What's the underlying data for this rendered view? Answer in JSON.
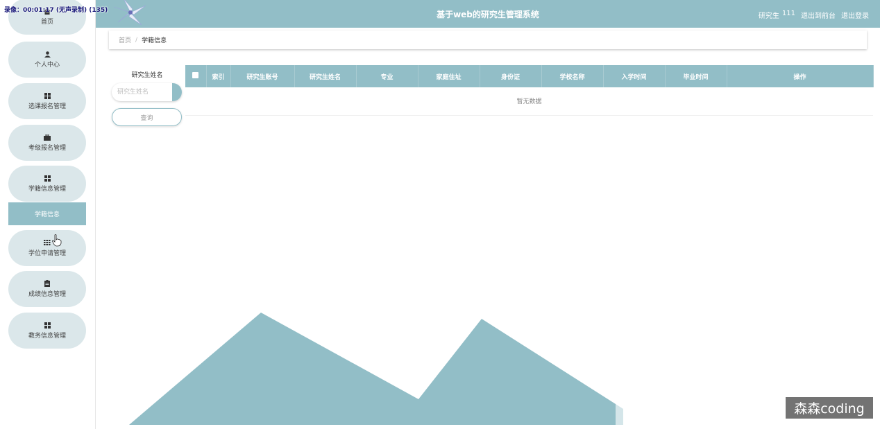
{
  "recording_overlay": "录像：00:01:17 (无声录制) (135)",
  "header": {
    "title": "基于web的研究生管理系统",
    "user_role": "研究生",
    "user_name": "111",
    "back_to_front": "退出到前台",
    "logout": "退出登录"
  },
  "sidebar": {
    "items": [
      {
        "label": "首页",
        "icon": "home-icon"
      },
      {
        "label": "个人中心",
        "icon": "user-icon"
      },
      {
        "label": "选课报名管理",
        "icon": "grid-icon"
      },
      {
        "label": "考级报名管理",
        "icon": "briefcase-icon"
      },
      {
        "label": "学籍信息管理",
        "icon": "grid-icon"
      },
      {
        "label": "学位申请管理",
        "icon": "grid-dense-icon"
      },
      {
        "label": "成绩信息管理",
        "icon": "clipboard-icon"
      },
      {
        "label": "教务信息管理",
        "icon": "grid-icon"
      }
    ],
    "active_sub_item": "学籍信息"
  },
  "breadcrumb": {
    "home": "首页",
    "separator": "/",
    "current": "学籍信息"
  },
  "search": {
    "label": "研究生姓名",
    "placeholder": "研究生姓名",
    "value": "",
    "button": "查询"
  },
  "table": {
    "columns": [
      "索引",
      "研究生账号",
      "研究生姓名",
      "专业",
      "家庭住址",
      "身份证",
      "学校名称",
      "入学时间",
      "毕业时间",
      "操作"
    ],
    "empty_text": "暂无数据"
  },
  "watermark": "森森coding",
  "colors": {
    "accent": "#92bec7",
    "pill": "#dbe7ea"
  }
}
